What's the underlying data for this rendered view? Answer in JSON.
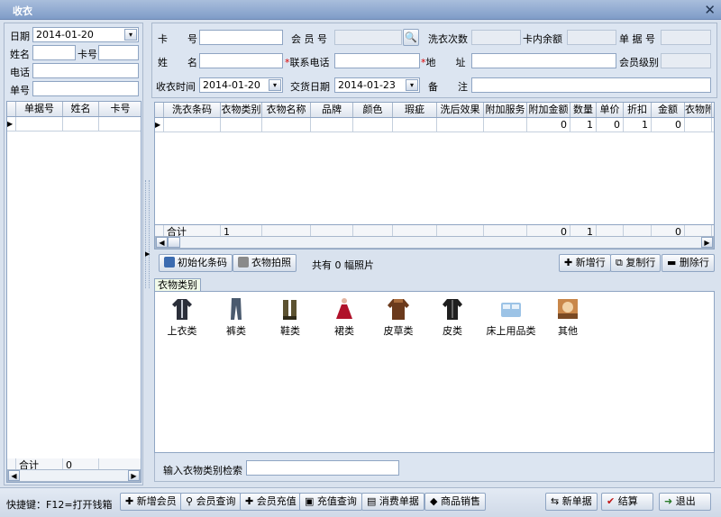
{
  "window": {
    "title": "收衣"
  },
  "left": {
    "date_label": "日期",
    "date_value": "2014-01-20",
    "name_label": "姓名",
    "name_value": "",
    "card_label": "卡号",
    "card_value": "",
    "phone_label": "电话",
    "phone_value": "",
    "order_label": "单号",
    "order_value": "",
    "columns": [
      "单据号",
      "姓名",
      "卡号"
    ],
    "total_label": "合计",
    "total_value": "0"
  },
  "form": {
    "card_label": "卡　　号",
    "member_label": "会 员 号",
    "wash_count_label": "洗衣次数",
    "balance_label": "卡内余额",
    "doc_no_label": "单 据 号",
    "name_label": "姓　　名",
    "contact_label": "联系电话",
    "address_label": "地　　址",
    "level_label": "会员级别",
    "receive_time_label": "收衣时间",
    "receive_time_value": "2014-01-20",
    "delivery_label": "交货日期",
    "delivery_value": "2014-01-23",
    "remark_label": "备　　注",
    "required_mark": "*"
  },
  "table": {
    "columns": [
      "洗衣条码",
      "衣物类别",
      "衣物名称",
      "品牌",
      "颜色",
      "瑕疵",
      "洗后效果",
      "附加服务",
      "附加金额",
      "数量",
      "单价",
      "折扣",
      "金额",
      "衣物附"
    ],
    "row": [
      "",
      "",
      "",
      "",
      "",
      "",
      "",
      "",
      "0",
      "1",
      "0",
      "1",
      "0",
      ""
    ],
    "total_label": "合计",
    "total_row": [
      "1",
      "",
      "",
      "",
      "",
      "",
      "",
      "0",
      "1",
      "",
      "",
      "0",
      ""
    ]
  },
  "toolbar": {
    "init_barcode": "初始化条码",
    "photo": "衣物拍照",
    "photo_count_prefix": "共有",
    "photo_count": "0",
    "photo_count_suffix": "幅照片",
    "new_row": "新增行",
    "copy_row": "复制行",
    "delete_row": "删除行"
  },
  "categories": {
    "tab": "衣物类别",
    "items": [
      {
        "label": "上衣类",
        "icon": "coat-icon"
      },
      {
        "label": "裤类",
        "icon": "pants-icon"
      },
      {
        "label": "鞋类",
        "icon": "shoes-icon"
      },
      {
        "label": "裙类",
        "icon": "dress-icon"
      },
      {
        "label": "皮草类",
        "icon": "fur-icon"
      },
      {
        "label": "皮类",
        "icon": "leather-icon"
      },
      {
        "label": "床上用品类",
        "icon": "bedding-icon"
      },
      {
        "label": "其他",
        "icon": "other-icon"
      }
    ],
    "search_label": "输入衣物类别检索"
  },
  "bottom": {
    "shortcut": "快捷键：F12=打开钱箱",
    "add_member": "新增会员",
    "member_query": "会员查询",
    "member_recharge": "会员充值",
    "recharge_query": "充值查询",
    "consume_docs": "消费单据",
    "goods_sales": "商品销售",
    "new_doc": "新单据",
    "checkout": "结算",
    "exit": "退出"
  }
}
